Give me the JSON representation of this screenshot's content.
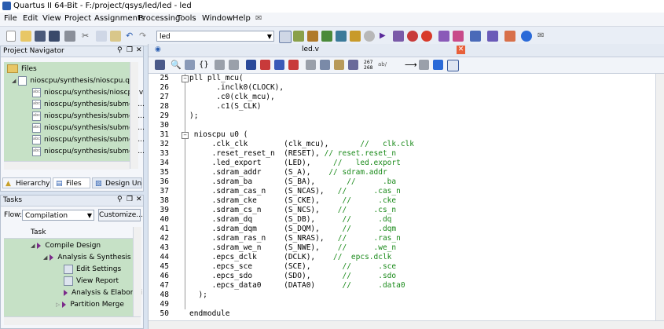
{
  "window": {
    "title": "Quartus II 64-Bit - F:/project/qsys/led/led - led"
  },
  "menu": [
    "File",
    "Edit",
    "View",
    "Project",
    "Assignments",
    "Processing",
    "Tools",
    "Window",
    "Help"
  ],
  "toolbar": {
    "entity_combo": "led"
  },
  "project_navigator": {
    "title": "Project Navigator",
    "root": "Files",
    "items": [
      "nioscpu/synthesis/nioscpu.qip",
      "nioscpu/synthesis/nioscpu.v",
      "nioscpu/synthesis/submod...",
      "nioscpu/synthesis/submod...",
      "nioscpu/synthesis/submod...",
      "nioscpu/synthesis/submod...",
      "nioscpu/synthesis/submod..."
    ],
    "tabs": [
      "Hierarchy",
      "Files",
      "Design Un"
    ]
  },
  "tasks": {
    "title": "Tasks",
    "flow_label": "Flow:",
    "flow_value": "Compilation",
    "customize_label": "Customize...",
    "column_header": "Task",
    "items": [
      "Compile Design",
      "Analysis & Synthesis",
      "Edit Settings",
      "View Report",
      "Analysis & Elaborati",
      "Partition Merge"
    ]
  },
  "editor": {
    "tab_label": "led.v",
    "lines": [
      {
        "n": "25",
        "code": "pll pll_mcu(",
        "comment": ""
      },
      {
        "n": "26",
        "code": "      .inclk0(CLOCK),",
        "comment": ""
      },
      {
        "n": "27",
        "code": "      .c0(clk_mcu),",
        "comment": ""
      },
      {
        "n": "28",
        "code": "      .c1(S_CLK)",
        "comment": ""
      },
      {
        "n": "29",
        "code": ");",
        "comment": ""
      },
      {
        "n": "30",
        "code": "",
        "comment": ""
      },
      {
        "n": "31",
        "code": " nioscpu u0 (",
        "comment": ""
      },
      {
        "n": "32",
        "code": "     .clk_clk        (clk_mcu),       ",
        "comment": "//   clk.clk"
      },
      {
        "n": "33",
        "code": "     .reset_reset_n  (RESET), ",
        "comment": "// reset.reset_n"
      },
      {
        "n": "34",
        "code": "     .led_export     (LED),     ",
        "comment": "//   led.export"
      },
      {
        "n": "35",
        "code": "     .sdram_addr     (S_A),    ",
        "comment": "// sdram.addr"
      },
      {
        "n": "36",
        "code": "     .sdram_ba       (S_BA),       ",
        "comment": "//      .ba"
      },
      {
        "n": "37",
        "code": "     .sdram_cas_n    (S_NCAS),   ",
        "comment": "//      .cas_n"
      },
      {
        "n": "38",
        "code": "     .sdram_cke      (S_CKE),     ",
        "comment": "//      .cke"
      },
      {
        "n": "39",
        "code": "     .sdram_cs_n     (S_NCS),    ",
        "comment": "//      .cs_n"
      },
      {
        "n": "40",
        "code": "     .sdram_dq       (S_DB),      ",
        "comment": "//      .dq"
      },
      {
        "n": "41",
        "code": "     .sdram_dqm      (S_DQM),     ",
        "comment": "//      .dqm"
      },
      {
        "n": "42",
        "code": "     .sdram_ras_n    (S_NRAS),   ",
        "comment": "//      .ras_n"
      },
      {
        "n": "43",
        "code": "     .sdram_we_n     (S_NWE),    ",
        "comment": "//      .we_n"
      },
      {
        "n": "44",
        "code": "     .epcs_dclk      (DCLK),    ",
        "comment": "//  epcs.dclk"
      },
      {
        "n": "45",
        "code": "     .epcs_sce       (SCE),       ",
        "comment": "//      .sce"
      },
      {
        "n": "46",
        "code": "     .epcs_sdo       (SDO),       ",
        "comment": "//      .sdo"
      },
      {
        "n": "47",
        "code": "     .epcs_data0     (DATA0)      ",
        "comment": "//      .data0"
      },
      {
        "n": "48",
        "code": "  );",
        "comment": ""
      },
      {
        "n": "49",
        "code": "",
        "comment": ""
      },
      {
        "n": "50",
        "code": "endmodule",
        "comment": ""
      }
    ]
  }
}
